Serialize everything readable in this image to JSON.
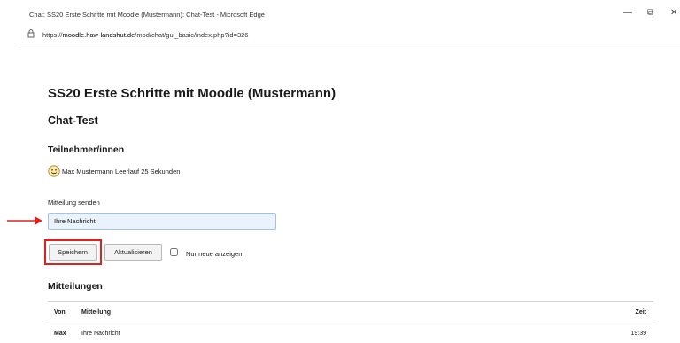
{
  "window": {
    "title": "Chat: SS20 Erste Schritte mit Moodle (Mustermann): Chat-Test - Microsoft Edge",
    "minimize": "—",
    "maximize": "⧉",
    "close": "✕"
  },
  "address": {
    "url_prefix": "https://",
    "url_host": "moodle.haw-landshut.de",
    "url_path": "/mod/chat/gui_basic/index.php?id=326"
  },
  "page": {
    "course_title": "SS20 Erste Schritte mit Moodle (Mustermann)",
    "chat_title": "Chat-Test",
    "participants_heading": "Teilnehmer/innen",
    "participants": [
      {
        "name": "Max Mustermann Leerlauf 25 Sekunden"
      }
    ],
    "send_label": "Mitteilung senden",
    "message_value": "Ihre Nachricht",
    "save_button": "Speichern",
    "refresh_button": "Aktualisieren",
    "new_only_label": "Nur neue anzeigen",
    "messages_heading": "Mitteilungen"
  },
  "messages_table": {
    "headers": {
      "from": "Von",
      "message": "Mitteilung",
      "time": "Zeit"
    },
    "rows": [
      {
        "from": "Max",
        "message": "Ihre Nachricht",
        "time": "19:39"
      }
    ]
  },
  "colors": {
    "highlight": "#e0201c",
    "input_bg": "#eaf3fc",
    "input_border": "#9ec5e8"
  },
  "icons": [
    "lock-icon",
    "smiley-icon",
    "red-arrow-icon"
  ]
}
